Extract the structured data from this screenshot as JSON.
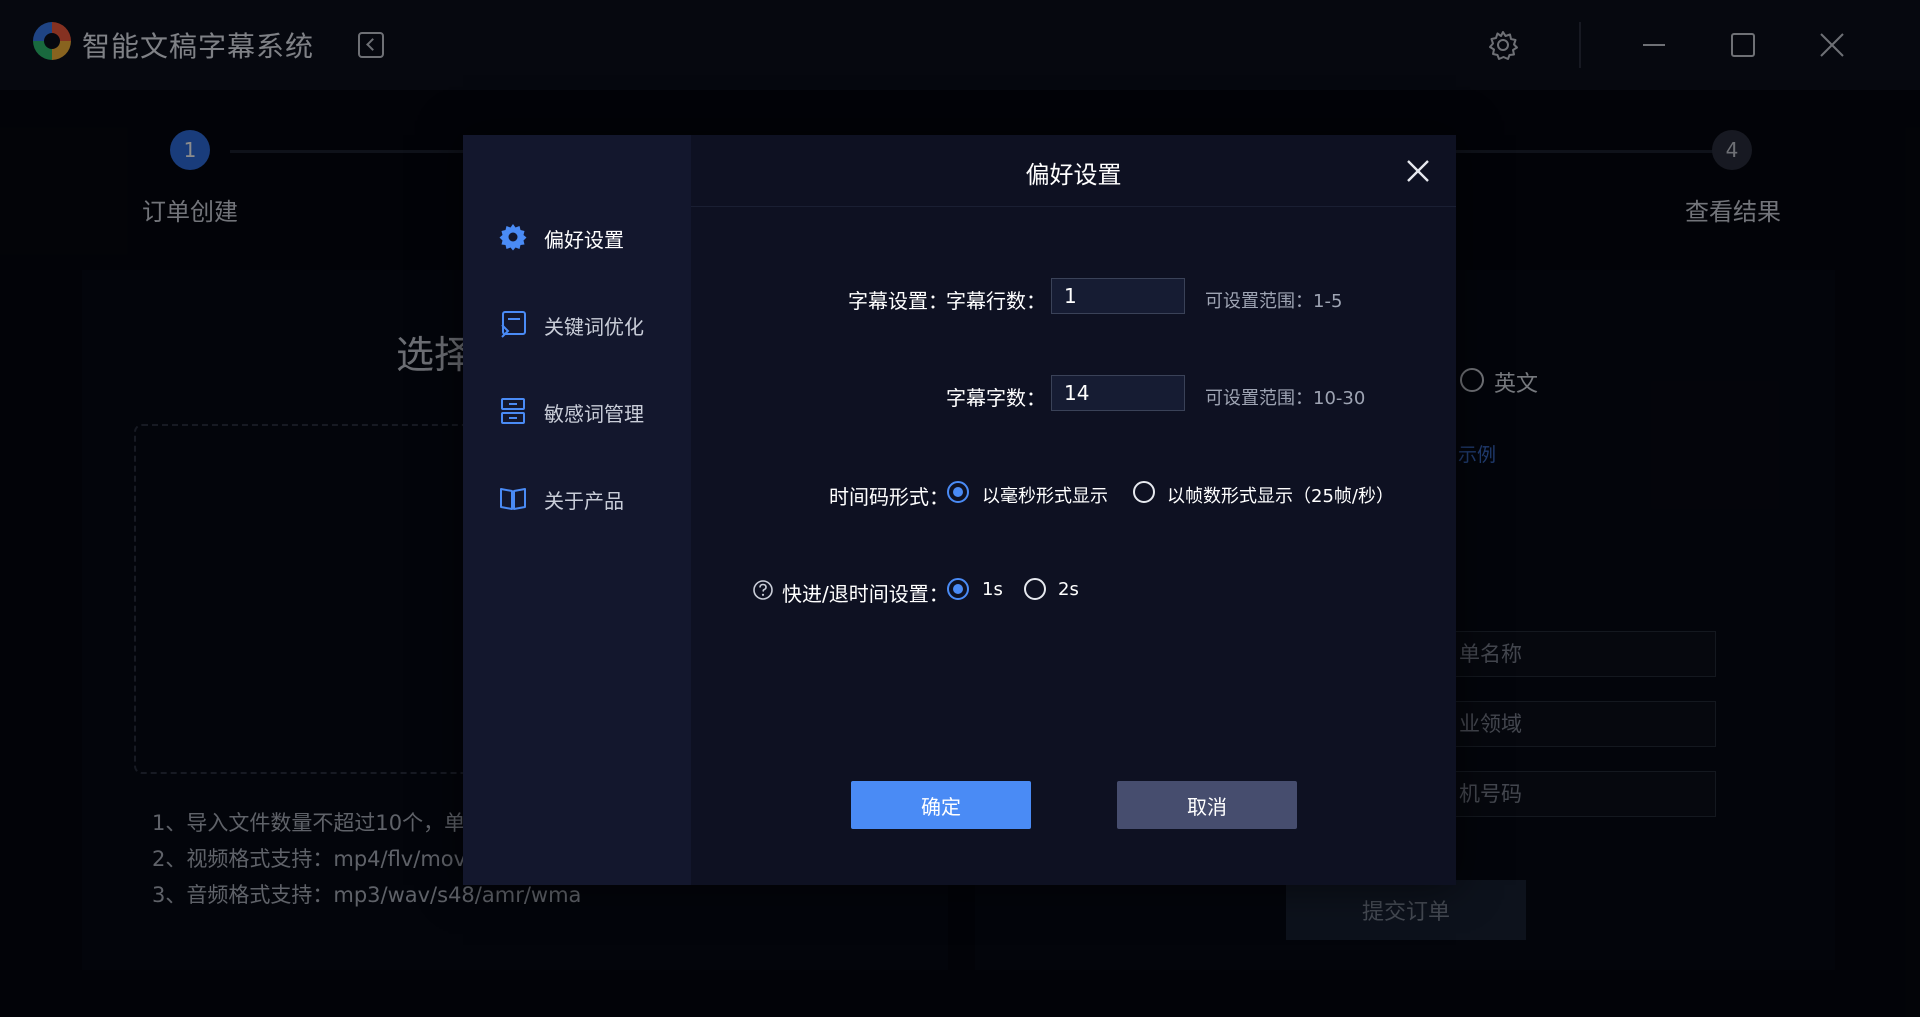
{
  "app": {
    "title": "智能文稿字幕系统",
    "window_controls": [
      "gear-icon",
      "minimize-icon",
      "maximize-icon",
      "close-icon"
    ]
  },
  "steps": {
    "step1_number": "1",
    "step1_label": "订单创建",
    "step4_number": "4",
    "step4_label": "查看结果"
  },
  "background": {
    "heading": "选择",
    "notes": [
      "1、导入文件数量不超过10个，单",
      "2、视频格式支持：mp4/flv/mov",
      "3、音频格式支持：mp3/wav/s48/amr/wma"
    ],
    "language_option": "英文",
    "example_link": "示例",
    "order_name_placeholder": "单名称",
    "domain_placeholder": "业领域",
    "phone_placeholder": "机号码",
    "submit_label": "提交订单"
  },
  "modal": {
    "title": "偏好设置",
    "sidebar": [
      {
        "label": "偏好设置",
        "icon": "gear-icon"
      },
      {
        "label": "关键词优化",
        "icon": "keyword-icon"
      },
      {
        "label": "敏感词管理",
        "icon": "filter-icon"
      },
      {
        "label": "关于产品",
        "icon": "book-icon"
      }
    ],
    "subtitle_settings_label": "字幕设置：",
    "lines_label": "字幕行数：",
    "lines_value": "1",
    "lines_hint": "可设置范围：1-5",
    "chars_label": "字幕字数：",
    "chars_value": "14",
    "chars_hint": "可设置范围：10-30",
    "timecode_label": "时间码形式：",
    "timecode_options": [
      "以毫秒形式显示",
      "以帧数形式显示（25帧/秒）"
    ],
    "timecode_selected": "以毫秒形式显示",
    "seek_label": "快进/退时间设置：",
    "seek_options": [
      "1s",
      "2s"
    ],
    "seek_selected": "1s",
    "ok_label": "确定",
    "cancel_label": "取消"
  },
  "colors": {
    "accent": "#4a8bf5",
    "modal_bg": "#0e1122",
    "sidebar_bg": "#13172d",
    "cancel_bg": "#464d6e"
  }
}
